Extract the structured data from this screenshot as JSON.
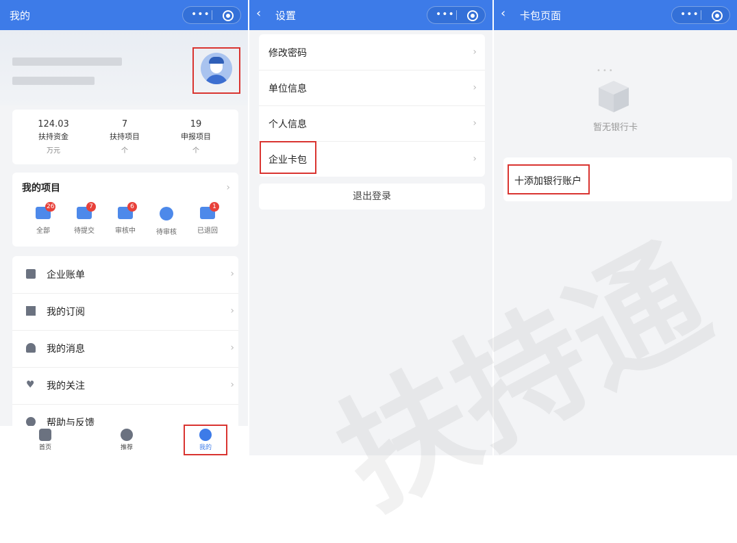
{
  "colors": {
    "primary": "#3d7be8",
    "badge": "#e8413a",
    "highlight": "#d9332f"
  },
  "panel1": {
    "title": "我的",
    "stats": [
      {
        "value": "124.03",
        "label": "扶持资金",
        "unit": "万元"
      },
      {
        "value": "7",
        "label": "扶持项目",
        "unit": "个"
      },
      {
        "value": "19",
        "label": "申报项目",
        "unit": "个"
      }
    ],
    "projects_title": "我的项目",
    "projects": [
      {
        "label": "全部",
        "badge": "26",
        "icon": "chat-icon"
      },
      {
        "label": "待提交",
        "badge": "7",
        "icon": "upload-icon"
      },
      {
        "label": "审核中",
        "badge": "6",
        "icon": "review-icon"
      },
      {
        "label": "待审核",
        "badge": "",
        "icon": "clock-icon"
      },
      {
        "label": "已退回",
        "badge": "1",
        "icon": "return-icon"
      }
    ],
    "menu": [
      {
        "label": "企业账单",
        "icon": "bill-icon"
      },
      {
        "label": "我的订阅",
        "icon": "bookmark-icon"
      },
      {
        "label": "我的消息",
        "icon": "bell-icon"
      },
      {
        "label": "我的关注",
        "icon": "heart-icon"
      },
      {
        "label": "帮助与反馈",
        "icon": "help-icon"
      }
    ],
    "tabs": [
      {
        "label": "首页",
        "icon": "home-icon"
      },
      {
        "label": "推荐",
        "icon": "recommend-icon"
      },
      {
        "label": "我的",
        "icon": "profile-icon"
      }
    ]
  },
  "panel2": {
    "title": "设置",
    "items": [
      {
        "label": "修改密码"
      },
      {
        "label": "单位信息"
      },
      {
        "label": "个人信息"
      },
      {
        "label": "企业卡包"
      }
    ],
    "logout": "退出登录"
  },
  "panel3": {
    "title": "卡包页面",
    "empty_text": "暂无银行卡",
    "add_label": "十添加银行账户"
  },
  "watermark": "扶持通"
}
